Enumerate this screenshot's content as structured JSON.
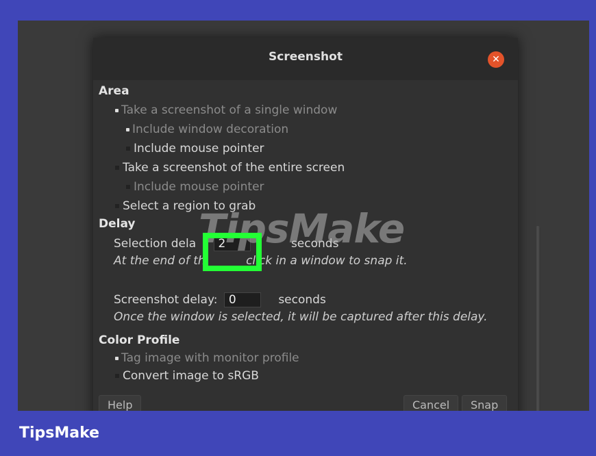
{
  "dialog": {
    "title": "Screenshot",
    "area": {
      "heading": "Area",
      "single_window": "Take a screenshot of a single window",
      "include_window_decoration": "Include window decoration",
      "include_mouse_pointer_1": "Include mouse pointer",
      "entire_screen": "Take a screenshot of the entire screen",
      "include_mouse_pointer_2": "Include mouse pointer",
      "select_region": "Select a region to grab"
    },
    "delay": {
      "heading": "Delay",
      "selection_delay_label": "Selection dela",
      "selection_delay_value": "2",
      "selection_seconds": "seconds",
      "selection_hint_1": "At the end of th",
      "selection_hint_2": "click in a window to snap it.",
      "screenshot_delay_label": "Screenshot delay:",
      "screenshot_delay_value": "0",
      "screenshot_seconds": "seconds",
      "screenshot_hint": "Once the window is selected, it will be captured after this delay."
    },
    "color_profile": {
      "heading": "Color Profile",
      "tag_image": "Tag image with monitor profile",
      "convert_srgb": "Convert image to sRGB"
    },
    "buttons": {
      "help": "Help",
      "cancel": "Cancel",
      "snap": "Snap"
    }
  },
  "watermark": "TipsMake",
  "brand": "TipsMake"
}
